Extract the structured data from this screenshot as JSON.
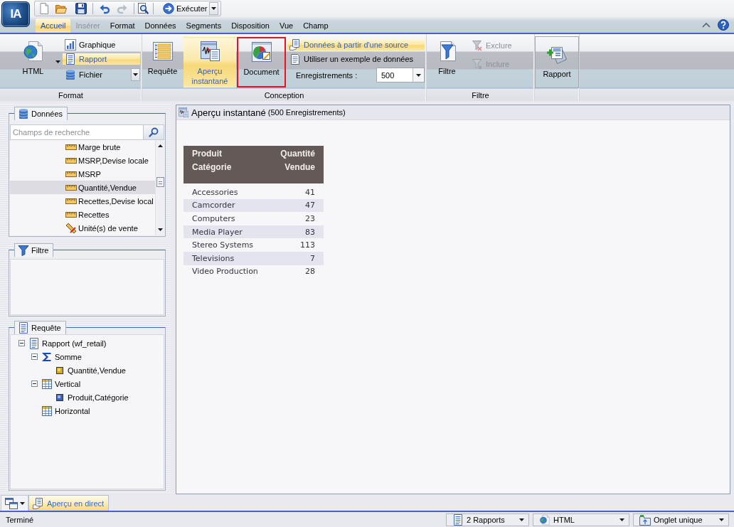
{
  "app": {
    "logo": "IA"
  },
  "quick_access": {
    "run": {
      "label": "Exécuter"
    }
  },
  "menu_tabs": [
    {
      "label": "Accueil",
      "selected": true,
      "disabled": false
    },
    {
      "label": "Insérer",
      "selected": false,
      "disabled": true
    },
    {
      "label": "Format",
      "selected": false,
      "disabled": false
    },
    {
      "label": "Données",
      "selected": false,
      "disabled": false
    },
    {
      "label": "Segments",
      "selected": false,
      "disabled": false
    },
    {
      "label": "Disposition",
      "selected": false,
      "disabled": false
    },
    {
      "label": "Vue",
      "selected": false,
      "disabled": false
    },
    {
      "label": "Champ",
      "selected": false,
      "disabled": false
    }
  ],
  "ribbon": {
    "format": {
      "label": "Format",
      "main": {
        "label": "HTML"
      },
      "items": [
        {
          "label": "Graphique",
          "selected": false
        },
        {
          "label": "Rapport",
          "selected": true
        },
        {
          "label": "Fichier",
          "selected": false
        }
      ]
    },
    "conception": {
      "label": "Conception",
      "buttons": [
        {
          "label": "Requête",
          "selected": false,
          "highlighted": false
        },
        {
          "label": "Aperçu instantané",
          "selected": true,
          "highlighted": false
        },
        {
          "label": "Document",
          "selected": false,
          "highlighted": true
        }
      ],
      "sources": [
        {
          "label": "Données à partir d'une source",
          "selected": true
        },
        {
          "label": "Utiliser un exemple de données",
          "selected": false
        }
      ],
      "records": {
        "label": "Enregistrements :",
        "value": "500"
      }
    },
    "filter": {
      "label": "Filtre",
      "main": {
        "label": "Filtre"
      },
      "items": [
        {
          "label": "Exclure",
          "disabled": true
        },
        {
          "label": "Inclure",
          "disabled": true
        }
      ]
    },
    "report": {
      "label": "Rapport"
    }
  },
  "data_panel": {
    "title": "Données",
    "search": {
      "placeholder": "Champs de recherche"
    },
    "fields": [
      {
        "label": "Marge brute",
        "kind": "measure",
        "selected": false
      },
      {
        "label": "MSRP,Devise locale",
        "kind": "measure",
        "selected": false
      },
      {
        "label": "MSRP",
        "kind": "measure",
        "selected": false
      },
      {
        "label": "Quantité,Vendue",
        "kind": "measure",
        "selected": true
      },
      {
        "label": "Recettes,Devise local",
        "kind": "measure",
        "selected": false
      },
      {
        "label": "Recettes",
        "kind": "measure",
        "selected": false
      },
      {
        "label": "Unité(s) de vente",
        "kind": "tool",
        "selected": false
      }
    ]
  },
  "filter_panel": {
    "title": "Filtre"
  },
  "query_panel": {
    "title": "Requête",
    "tree": [
      {
        "label": "Rapport (wf_retail)",
        "kind": "report",
        "expanded": true,
        "children": [
          {
            "label": "Somme",
            "kind": "sum",
            "expanded": true,
            "children": [
              {
                "label": "Quantité,Vendue",
                "kind": "measure"
              }
            ]
          },
          {
            "label": "Vertical",
            "kind": "grid",
            "expanded": true,
            "children": [
              {
                "label": "Produit,Catégorie",
                "kind": "dimension"
              }
            ]
          },
          {
            "label": "Horizontal",
            "kind": "grid"
          }
        ]
      }
    ]
  },
  "preview": {
    "title": "Aperçu instantané",
    "record_count": "(500 Enregistrements)",
    "table": {
      "columns": [
        "Produit\nCatégorie",
        "Quantité\nVendue"
      ],
      "rows": [
        [
          "Accessories",
          "41"
        ],
        [
          "Camcorder",
          "47"
        ],
        [
          "Computers",
          "23"
        ],
        [
          "Media Player",
          "83"
        ],
        [
          "Stereo Systems",
          "113"
        ],
        [
          "Televisions",
          "7"
        ],
        [
          "Video Production",
          "28"
        ]
      ]
    }
  },
  "view_tabs": [
    {
      "label": "Aperçu en direct",
      "selected": true
    }
  ],
  "status_bar": {
    "message": "Terminé",
    "selectors": [
      {
        "kind": "reports",
        "value": "2 Rapports"
      },
      {
        "kind": "format",
        "value": "HTML"
      },
      {
        "kind": "layout",
        "value": "Onglet unique"
      }
    ]
  }
}
